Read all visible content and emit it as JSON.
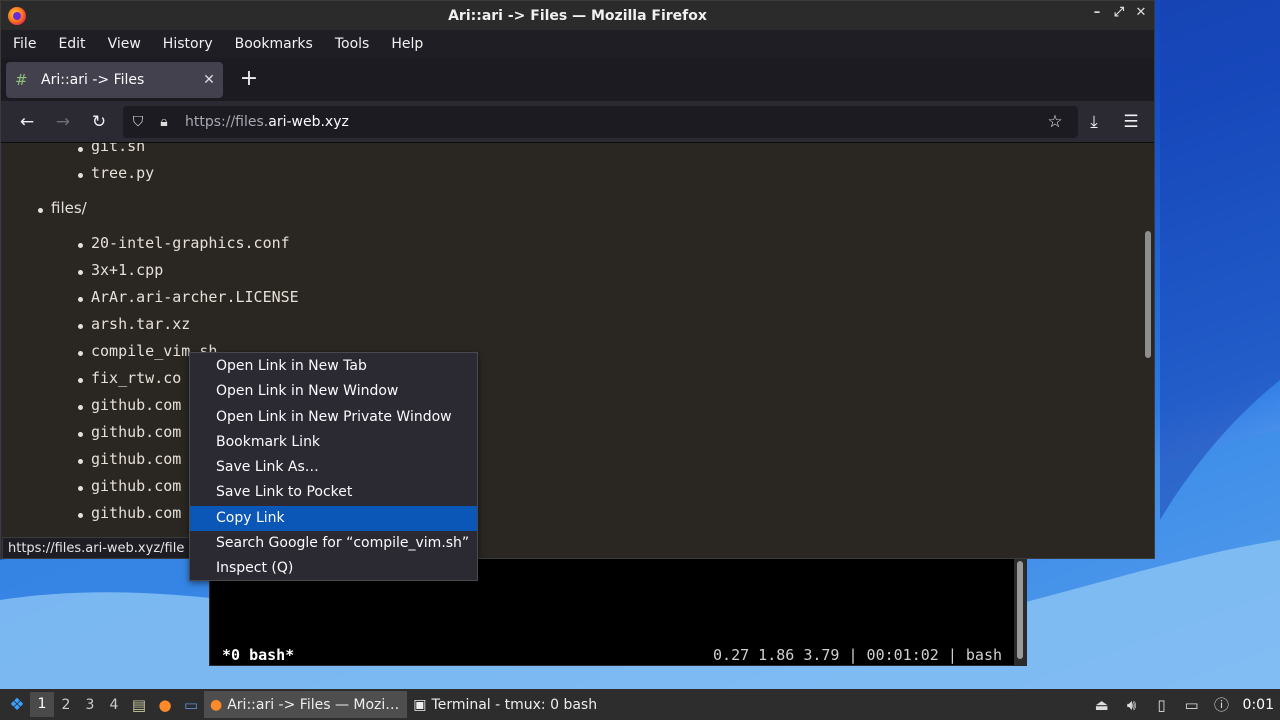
{
  "window": {
    "title": "Ari::ari -> Files — Mozilla Firefox",
    "controls": [
      "–",
      "⤢",
      "✕"
    ]
  },
  "menubar": [
    "File",
    "Edit",
    "View",
    "History",
    "Bookmarks",
    "Tools",
    "Help"
  ],
  "tab": {
    "title": "Ari::ari -> Files",
    "close": "✕",
    "newtab": "+"
  },
  "navbar": {
    "url_prefix": "https://files.",
    "url_domain": "ari-web.xyz"
  },
  "content": {
    "scripts_items": [
      "git.sh",
      "tree.py"
    ],
    "files_dir": "files/",
    "files_items": [
      "20-intel-graphics.conf",
      "3x+1.cpp",
      "ArAr.ari-archer.LICENSE",
      "arsh.tar.xz",
      "compile_vim.sh",
      "fix_rtw.co",
      "github.com",
      "github.com",
      "github.com",
      "github.com",
      "github.com"
    ]
  },
  "status_url": "https://files.ari-web.xyz/file",
  "context_menu": [
    "Open Link in New Tab",
    "Open Link in New Window",
    "Open Link in New Private Window",
    "Bookmark Link",
    "Save Link As…",
    "Save Link to Pocket",
    "Copy Link",
    "Search Google for “compile_vim.sh”",
    "Inspect (Q)"
  ],
  "context_active_index": 6,
  "terminal": {
    "window_label": "*0 bash*",
    "status_right": "0.27 1.86 3.79 | 00:01:02 | bash"
  },
  "taskbar": {
    "workspaces": [
      "1",
      "2",
      "3",
      "4"
    ],
    "current_workspace": "1",
    "tasks": [
      {
        "label": "Ari::ari -> Files — Mozi…",
        "icon": "firefox-icon"
      },
      {
        "label": "Terminal - tmux: 0 bash",
        "icon": "terminal-icon"
      }
    ],
    "clock": "0:01"
  },
  "colors": {
    "accent": "#0b57b8",
    "content_bg": "#2a2622",
    "chrome_bg": "#2b2a33"
  }
}
